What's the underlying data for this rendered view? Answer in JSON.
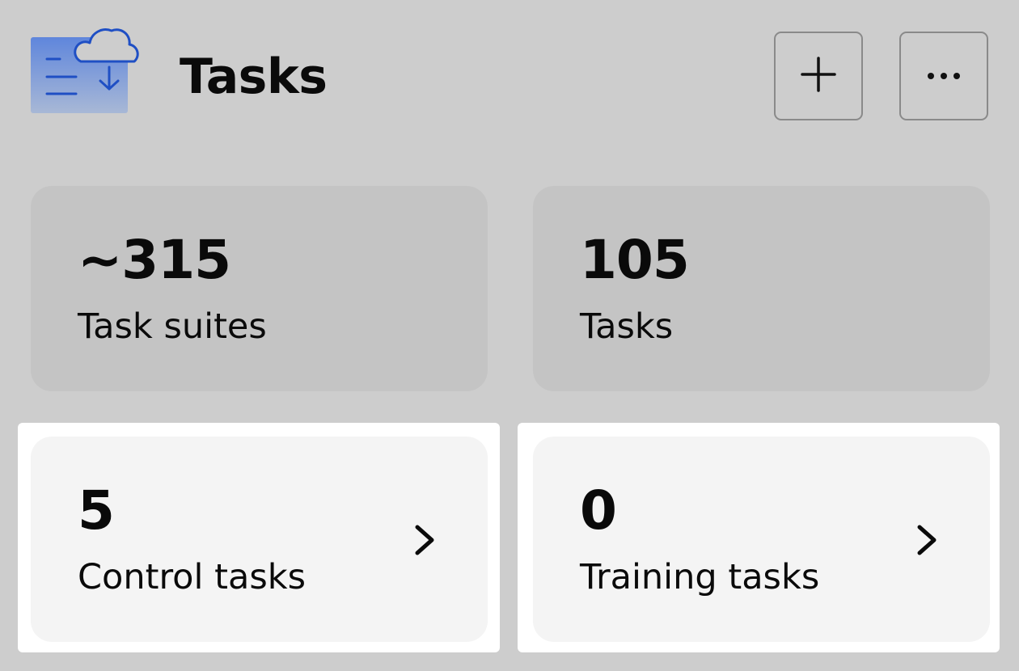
{
  "header": {
    "title": "Tasks",
    "icon": "tasks-cloud-icon",
    "add_button_icon": "plus-icon",
    "more_button_icon": "more-horizontal-icon"
  },
  "stats": [
    {
      "value": "~315",
      "label": "Task suites"
    },
    {
      "value": "105",
      "label": "Tasks"
    }
  ],
  "links": [
    {
      "value": "5",
      "label": "Control tasks",
      "icon": "chevron-right-icon"
    },
    {
      "value": "0",
      "label": "Training tasks",
      "icon": "chevron-right-icon"
    }
  ],
  "colors": {
    "background": "#cdcdcd",
    "stat_card": "#c4c4c4",
    "link_card": "#f4f4f4",
    "icon_accent": "#1f4fc4"
  }
}
